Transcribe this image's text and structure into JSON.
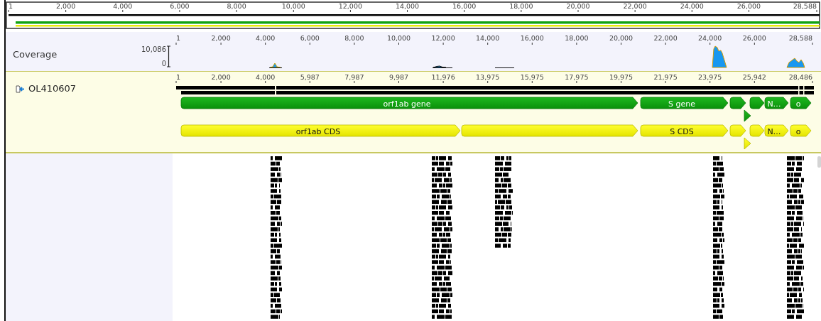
{
  "overview": {
    "ticks": [
      "1",
      "2,000",
      "4,000",
      "6,000",
      "8,000",
      "10,000",
      "12,000",
      "14,000",
      "16,000",
      "18,000",
      "20,000",
      "22,000",
      "24,000",
      "26,000",
      "28,588"
    ]
  },
  "coverage": {
    "label": "Coverage",
    "scale_max": "10,086",
    "scale_min": "0",
    "ticks": [
      "1",
      "2,000",
      "4,000",
      "6,000",
      "8,000",
      "10,000",
      "12,000",
      "14,000",
      "16,000",
      "18,000",
      "20,000",
      "22,000",
      "24,000",
      "26,000",
      "28,588"
    ]
  },
  "sequence": {
    "name": "OL410607",
    "ticks": [
      "1",
      "2,000",
      "4,000",
      "5,987",
      "7,987",
      "9,987",
      "11,976",
      "13,975",
      "15,975",
      "17,975",
      "19,975",
      "21,975",
      "23,975",
      "25,942",
      "28,486"
    ],
    "annotations": [
      {
        "kind": "gene",
        "label": "orf1ab gene"
      },
      {
        "kind": "gene",
        "label": "S gene"
      },
      {
        "kind": "gene"
      },
      {
        "kind": "gene"
      },
      {
        "kind": "gene",
        "label": "N…"
      },
      {
        "kind": "gene",
        "label": "o"
      },
      {
        "kind": "gene"
      },
      {
        "kind": "cds",
        "label": "orf1ab CDS"
      },
      {
        "kind": "cds"
      },
      {
        "kind": "cds",
        "label": "S CDS"
      },
      {
        "kind": "cds"
      },
      {
        "kind": "cds"
      },
      {
        "kind": "cds",
        "label": "N…"
      },
      {
        "kind": "cds",
        "label": "o"
      },
      {
        "kind": "cds"
      }
    ]
  }
}
